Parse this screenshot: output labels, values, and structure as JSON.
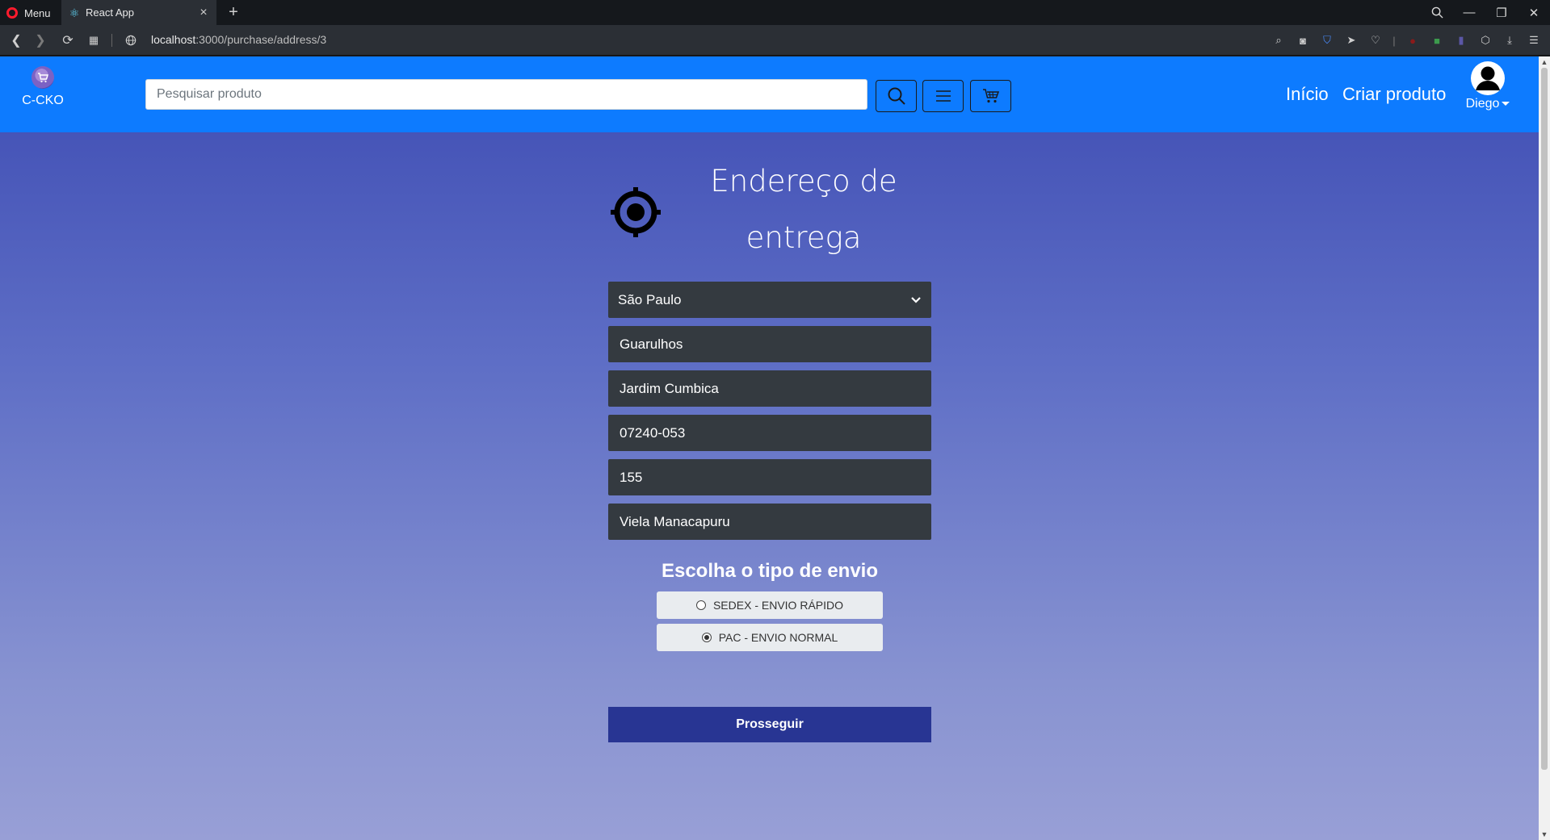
{
  "browser": {
    "menu_label": "Menu",
    "tab_title": "React App",
    "url_host": "localhost",
    "url_path": ":3000/purchase/address/3"
  },
  "navbar": {
    "brand": "C-CKO",
    "search_placeholder": "Pesquisar produto",
    "links": [
      "Início",
      "Criar produto"
    ],
    "user_name": "Diego"
  },
  "address": {
    "title": "Endereço de entrega",
    "state": "São Paulo",
    "city": "Guarulhos",
    "neighborhood": "Jardim Cumbica",
    "zip": "07240-053",
    "number": "155",
    "street": "Viela Manacapuru"
  },
  "shipping": {
    "title": "Escolha o tipo de envio",
    "options": [
      {
        "label": "SEDEX - ENVIO RÁPIDO",
        "selected": false
      },
      {
        "label": "PAC - ENVIO NORMAL",
        "selected": true
      }
    ]
  },
  "actions": {
    "proceed": "Prosseguir"
  },
  "colors": {
    "navbar": "#0d7bff",
    "field_bg": "#343a40",
    "button_bg": "#283593"
  }
}
